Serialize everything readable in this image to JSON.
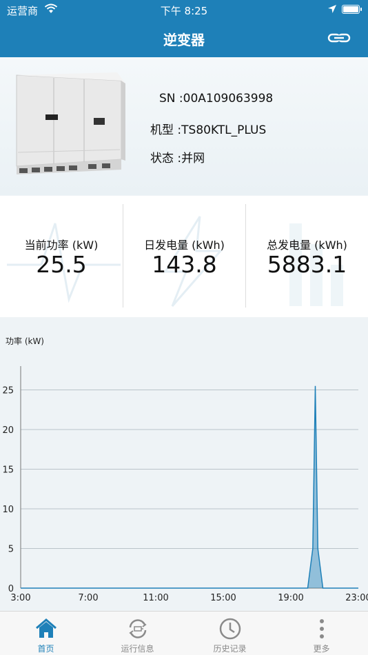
{
  "status_bar": {
    "carrier": "运营商",
    "time": "下午 8:25"
  },
  "nav": {
    "title": "逆变器"
  },
  "device": {
    "sn_label": "SN :",
    "sn_value": "00A109063998",
    "model_label": "机型 :",
    "model_value": "TS80KTL_PLUS",
    "state_label": "状态 :",
    "state_value": "并网"
  },
  "stats": [
    {
      "label": "当前功率 (kW)",
      "value": "25.5"
    },
    {
      "label": "日发电量 (kWh)",
      "value": "143.8"
    },
    {
      "label": "总发电量 (kWh)",
      "value": "5883.1"
    }
  ],
  "chart_data": {
    "type": "area",
    "ylabel": "功率 (kW)",
    "xlabel": "",
    "x_ticks": [
      "3:00",
      "7:00",
      "11:00",
      "15:00",
      "19:00",
      "23:00"
    ],
    "y_ticks": [
      "0",
      "5",
      "10",
      "15",
      "20",
      "25"
    ],
    "ylim": [
      0,
      28
    ],
    "xlim_hours": [
      3,
      23
    ],
    "grid": true,
    "color": "#1e80b8",
    "series": [
      {
        "x_hours": [
          3,
          20.0,
          20.3,
          20.45,
          20.6,
          20.9,
          23
        ],
        "values": [
          0,
          0,
          5,
          25.5,
          5,
          0,
          0
        ]
      }
    ]
  },
  "tabs": [
    {
      "label": "首页",
      "icon": "home-icon",
      "active": true
    },
    {
      "label": "运行信息",
      "icon": "run-info-icon",
      "active": false
    },
    {
      "label": "历史记录",
      "icon": "clock-icon",
      "active": false
    },
    {
      "label": "更多",
      "icon": "more-icon",
      "active": false
    }
  ]
}
